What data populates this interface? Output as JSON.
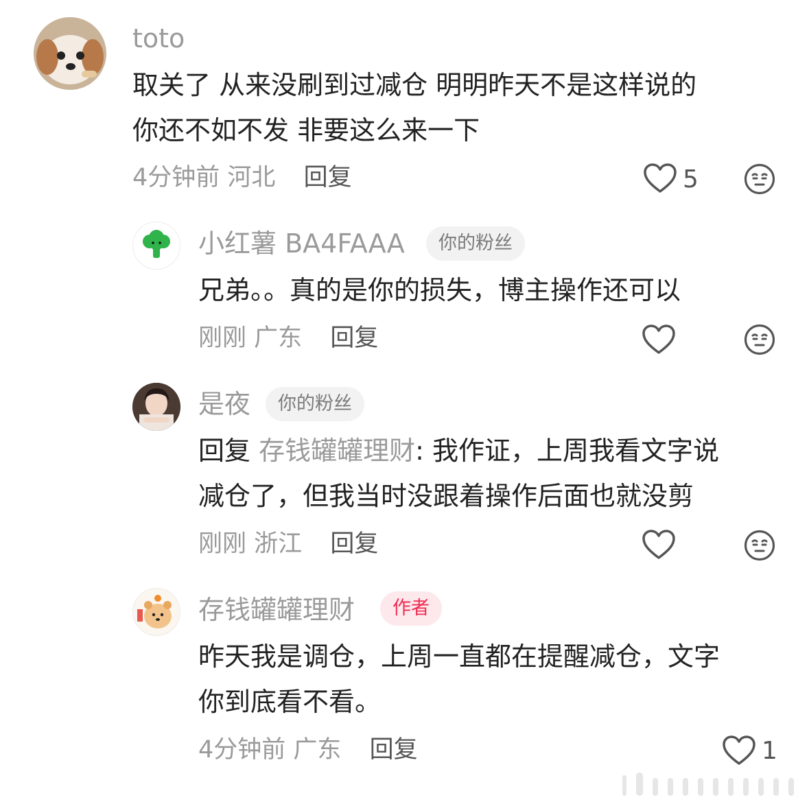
{
  "comments": [
    {
      "username": "toto",
      "badge": "",
      "lines": [
        "取关了 从来没刷到过减仓 明明昨天不是这样说的",
        "你还不如不发 非要这么来一下"
      ],
      "time": "4分钟前",
      "location": "河北",
      "reply_label": "回复",
      "like_count": "5"
    },
    {
      "username": "小红薯 BA4FAAA",
      "badge": "你的粉丝",
      "lines": [
        "兄弟。。真的是你的损失，博主操作还可以"
      ],
      "time": "刚刚",
      "location": "广东",
      "reply_label": "回复",
      "like_count": ""
    },
    {
      "username": "是夜",
      "badge": "你的粉丝",
      "reply_prefix": "回复",
      "reply_target": "存钱罐罐理财",
      "lines": [
        ": 我作证，上周我看文字说",
        "减仓了，但我当时没跟着操作后面也就没剪"
      ],
      "time": "刚刚",
      "location": "浙江",
      "reply_label": "回复",
      "like_count": ""
    },
    {
      "username": "存钱罐罐理财",
      "badge": "作者",
      "lines": [
        "昨天我是调仓，上周一直都在提醒减仓，文字",
        "你到底看不看。"
      ],
      "time": "4分钟前",
      "location": "广东",
      "reply_label": "回复",
      "like_count": "1"
    }
  ],
  "icons": {
    "like": "heart-outline-icon",
    "dislike": "neutral-face-icon"
  },
  "colors": {
    "author_badge_text": "#ef2d52",
    "author_badge_bg": "#fde8ec",
    "fan_badge_bg": "#f2f2f2",
    "username": "#9a9a9a",
    "content": "#222222"
  }
}
